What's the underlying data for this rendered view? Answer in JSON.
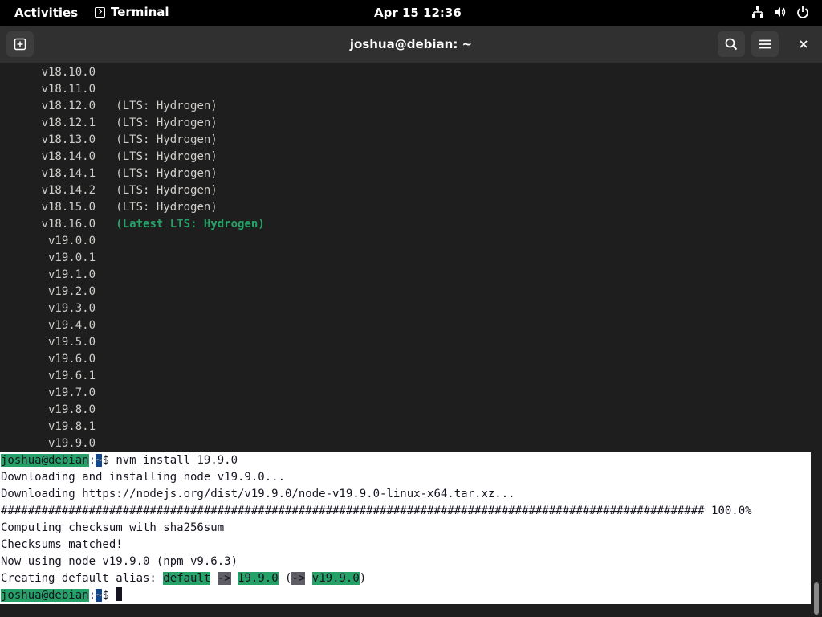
{
  "topbar": {
    "activities": "Activities",
    "app": "Terminal",
    "clock": "Apr 15  12:36",
    "tray_icons": [
      "network-icon",
      "volume-icon",
      "power-icon"
    ]
  },
  "window": {
    "title": "joshua@debian: ~",
    "buttons": [
      "new-tab-icon",
      "search-icon",
      "hamburger-menu-icon",
      "close-icon"
    ]
  },
  "terminal": {
    "version_list": [
      {
        "version": "      v18.10.0",
        "note": ""
      },
      {
        "version": "      v18.11.0",
        "note": ""
      },
      {
        "version": "      v18.12.0",
        "note": "   (LTS: Hydrogen)"
      },
      {
        "version": "      v18.12.1",
        "note": "   (LTS: Hydrogen)"
      },
      {
        "version": "      v18.13.0",
        "note": "   (LTS: Hydrogen)"
      },
      {
        "version": "      v18.14.0",
        "note": "   (LTS: Hydrogen)"
      },
      {
        "version": "      v18.14.1",
        "note": "   (LTS: Hydrogen)"
      },
      {
        "version": "      v18.14.2",
        "note": "   (LTS: Hydrogen)"
      },
      {
        "version": "      v18.15.0",
        "note": "   (LTS: Hydrogen)"
      },
      {
        "version": "      v18.16.0",
        "note": "   (Latest LTS: Hydrogen)",
        "latest": true
      },
      {
        "version": "       v19.0.0",
        "note": ""
      },
      {
        "version": "       v19.0.1",
        "note": ""
      },
      {
        "version": "       v19.1.0",
        "note": ""
      },
      {
        "version": "       v19.2.0",
        "note": ""
      },
      {
        "version": "       v19.3.0",
        "note": ""
      },
      {
        "version": "       v19.4.0",
        "note": ""
      },
      {
        "version": "       v19.5.0",
        "note": ""
      },
      {
        "version": "       v19.6.0",
        "note": ""
      },
      {
        "version": "       v19.6.1",
        "note": ""
      },
      {
        "version": "       v19.7.0",
        "note": ""
      },
      {
        "version": "       v19.8.0",
        "note": ""
      },
      {
        "version": "       v19.8.1",
        "note": ""
      },
      {
        "version": "       v19.9.0",
        "note": ""
      }
    ],
    "prompt_user": "joshua@debian",
    "prompt_sep": ":",
    "prompt_dir": "~",
    "prompt_dollar": "$ ",
    "command": "nvm install 19.9.0",
    "output": [
      "Downloading and installing node v19.9.0...",
      "Downloading https://nodejs.org/dist/v19.9.0/node-v19.9.0-linux-x64.tar.xz...",
      "######################################################################################################## 100.0%",
      "Computing checksum with sha256sum",
      "Checksums matched!",
      "Now using node v19.9.0 (npm v9.6.3)"
    ],
    "alias_line": {
      "prefix": "Creating default alias: ",
      "name": "default",
      "arrow1": "->",
      "target": "19.9.0",
      "paren_open": " (",
      "arrow2": "->",
      "resolved": "v19.9.0",
      "paren_close": ")"
    },
    "colors": {
      "background": "#1e1e1e",
      "highlight_green": "#26a269",
      "highlight_blue": "#12488b"
    }
  }
}
